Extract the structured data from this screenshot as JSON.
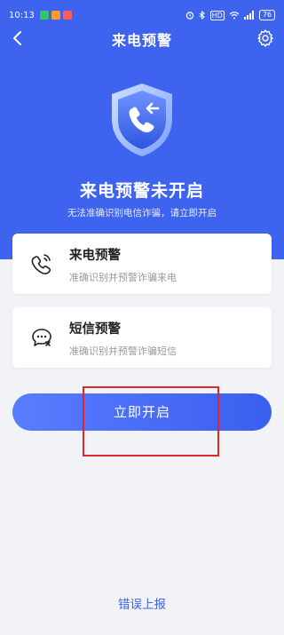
{
  "status_bar": {
    "time": "10:13",
    "network": "HD",
    "battery": "76"
  },
  "header": {
    "title": "来电预警"
  },
  "hero": {
    "headline": "来电预警未开启",
    "subline": "无法准确识别电信诈骗，请立即开启"
  },
  "cards": [
    {
      "title": "来电预警",
      "desc": "准确识别并预警诈骗来电",
      "icon": "phone-alert-icon"
    },
    {
      "title": "短信预警",
      "desc": "准确识别并预警诈骗短信",
      "icon": "message-alert-icon"
    }
  ],
  "primary_button": {
    "label": "立即开启"
  },
  "report_link": {
    "label": "错误上报"
  },
  "colors": {
    "brand_blue": "#3d63ef",
    "annotation_red": "#e1262b"
  }
}
